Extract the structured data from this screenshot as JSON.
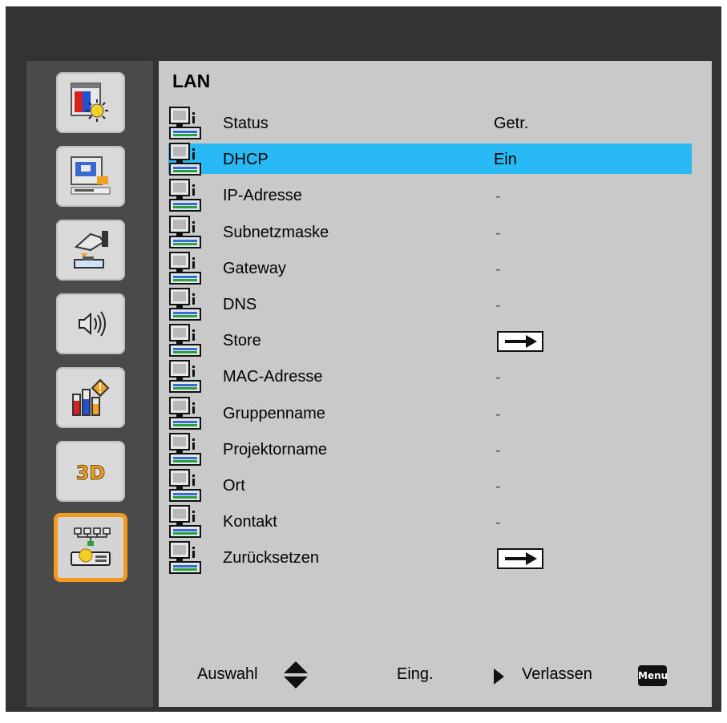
{
  "menu": {
    "title": "LAN",
    "sidebar": [
      {
        "icon": "image-settings-icon"
      },
      {
        "icon": "display-settings-icon"
      },
      {
        "icon": "setup-settings-icon"
      },
      {
        "icon": "audio-settings-icon"
      },
      {
        "icon": "options-settings-icon"
      },
      {
        "icon": "3d-settings-icon",
        "text": "3D"
      },
      {
        "icon": "network-settings-icon",
        "active": true
      }
    ],
    "rows": [
      {
        "label": "Status",
        "value": "Getr.",
        "kind": "text"
      },
      {
        "label": "DHCP",
        "value": "Ein",
        "kind": "text",
        "selected": true
      },
      {
        "label": "IP-Adresse",
        "value": "-",
        "kind": "dash"
      },
      {
        "label": "Subnetzmaske",
        "value": "-",
        "kind": "dash"
      },
      {
        "label": "Gateway",
        "value": "-",
        "kind": "dash"
      },
      {
        "label": "DNS",
        "value": "-",
        "kind": "dash"
      },
      {
        "label": "Store",
        "value": "",
        "kind": "arrow"
      },
      {
        "label": "MAC-Adresse",
        "value": "-",
        "kind": "dash"
      },
      {
        "label": "Gruppenname",
        "value": "-",
        "kind": "dash"
      },
      {
        "label": "Projektorname",
        "value": "-",
        "kind": "dash"
      },
      {
        "label": "Ort",
        "value": "-",
        "kind": "dash"
      },
      {
        "label": "Kontakt",
        "value": "-",
        "kind": "dash"
      },
      {
        "label": "Zurücksetzen",
        "value": "",
        "kind": "arrow"
      }
    ],
    "footer": {
      "select_label": "Auswahl",
      "enter_label": "Eing.",
      "exit_label": "Verlassen",
      "menu_key": "Menu"
    },
    "colors": {
      "highlight": "#29b9f5",
      "active_tile_border": "#f29a1f"
    }
  }
}
